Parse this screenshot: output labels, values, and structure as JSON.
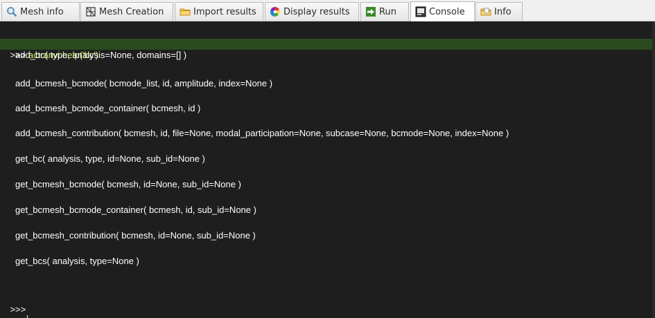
{
  "tabs": [
    {
      "label": "Mesh info",
      "icon": "magnifier-icon"
    },
    {
      "label": "Mesh Creation",
      "icon": "mesh-grid-icon"
    },
    {
      "label": "Import results",
      "icon": "folder-icon"
    },
    {
      "label": "Display results",
      "icon": "color-wheel-icon"
    },
    {
      "label": "Run",
      "icon": "run-arrow-icon"
    },
    {
      "label": "Console",
      "icon": "console-icon",
      "active": true
    },
    {
      "label": "Info",
      "icon": "info-folder-icon"
    }
  ],
  "console": {
    "prompt": ">>>",
    "command": "actranvi.help('bc')",
    "functions": [
      "add_bc( type, analysis=None, domains=[] )",
      "add_bcmesh_bcmode( bcmode_list, id, amplitude, index=None )",
      "add_bcmesh_bcmode_container( bcmesh, id )",
      "add_bcmesh_contribution( bcmesh, id, file=None, modal_participation=None, subcase=None, bcmode=None, index=None )",
      "get_bc( analysis, type, id=None, sub_id=None )",
      "get_bcmesh_bcmode( bcmesh, id=None, sub_id=None )",
      "get_bcmesh_bcmode_container( bcmesh, id, sub_id=None )",
      "get_bcmesh_contribution( bcmesh, id=None, sub_id=None )",
      "get_bcs( analysis, type=None )"
    ]
  },
  "colors": {
    "background": "#1e1e1e",
    "highlight": "#2a4a20",
    "command": "#c8f05a"
  }
}
